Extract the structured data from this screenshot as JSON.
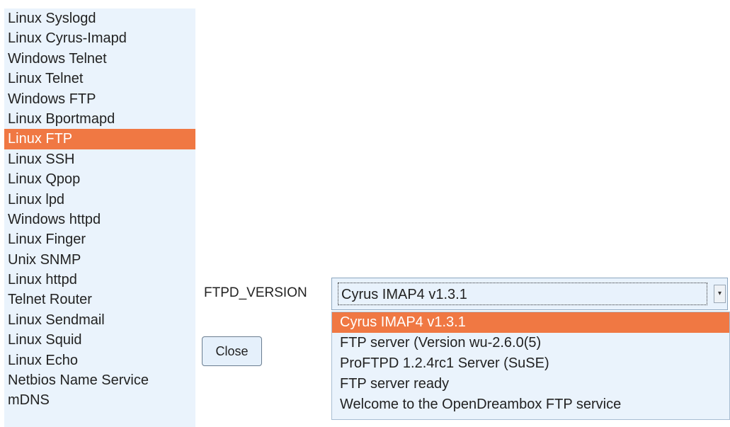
{
  "services": {
    "items": [
      {
        "label": "Linux Syslogd"
      },
      {
        "label": "Linux Cyrus-Imapd"
      },
      {
        "label": "Windows Telnet"
      },
      {
        "label": "Linux Telnet"
      },
      {
        "label": "Windows FTP"
      },
      {
        "label": "Linux Bportmapd"
      },
      {
        "label": "Linux FTP"
      },
      {
        "label": "Linux SSH"
      },
      {
        "label": "Linux Qpop"
      },
      {
        "label": "Linux lpd"
      },
      {
        "label": "Windows httpd"
      },
      {
        "label": "Linux Finger"
      },
      {
        "label": "Unix SNMP"
      },
      {
        "label": "Linux httpd"
      },
      {
        "label": "Telnet Router"
      },
      {
        "label": "Linux Sendmail"
      },
      {
        "label": "Linux Squid"
      },
      {
        "label": "Linux Echo"
      },
      {
        "label": "Netbios Name Service"
      },
      {
        "label": "mDNS"
      }
    ],
    "selected": "Linux FTP"
  },
  "ftpd": {
    "label": "FTPD_VERSION",
    "value": "Cyrus IMAP4 v1.3.1",
    "options": [
      {
        "label": "Cyrus IMAP4 v1.3.1"
      },
      {
        "label": "FTP server (Version wu-2.6.0(5)"
      },
      {
        "label": "ProFTPD 1.2.4rc1 Server (SuSE)"
      },
      {
        "label": "FTP server ready"
      },
      {
        "label": "Welcome to the OpenDreambox FTP service"
      }
    ],
    "highlighted": "Cyrus IMAP4 v1.3.1",
    "arrow_icon": "chevron-down-icon"
  },
  "close_label": "Close",
  "colors": {
    "highlight": "#f07843",
    "panel": "#eaf3fc"
  }
}
